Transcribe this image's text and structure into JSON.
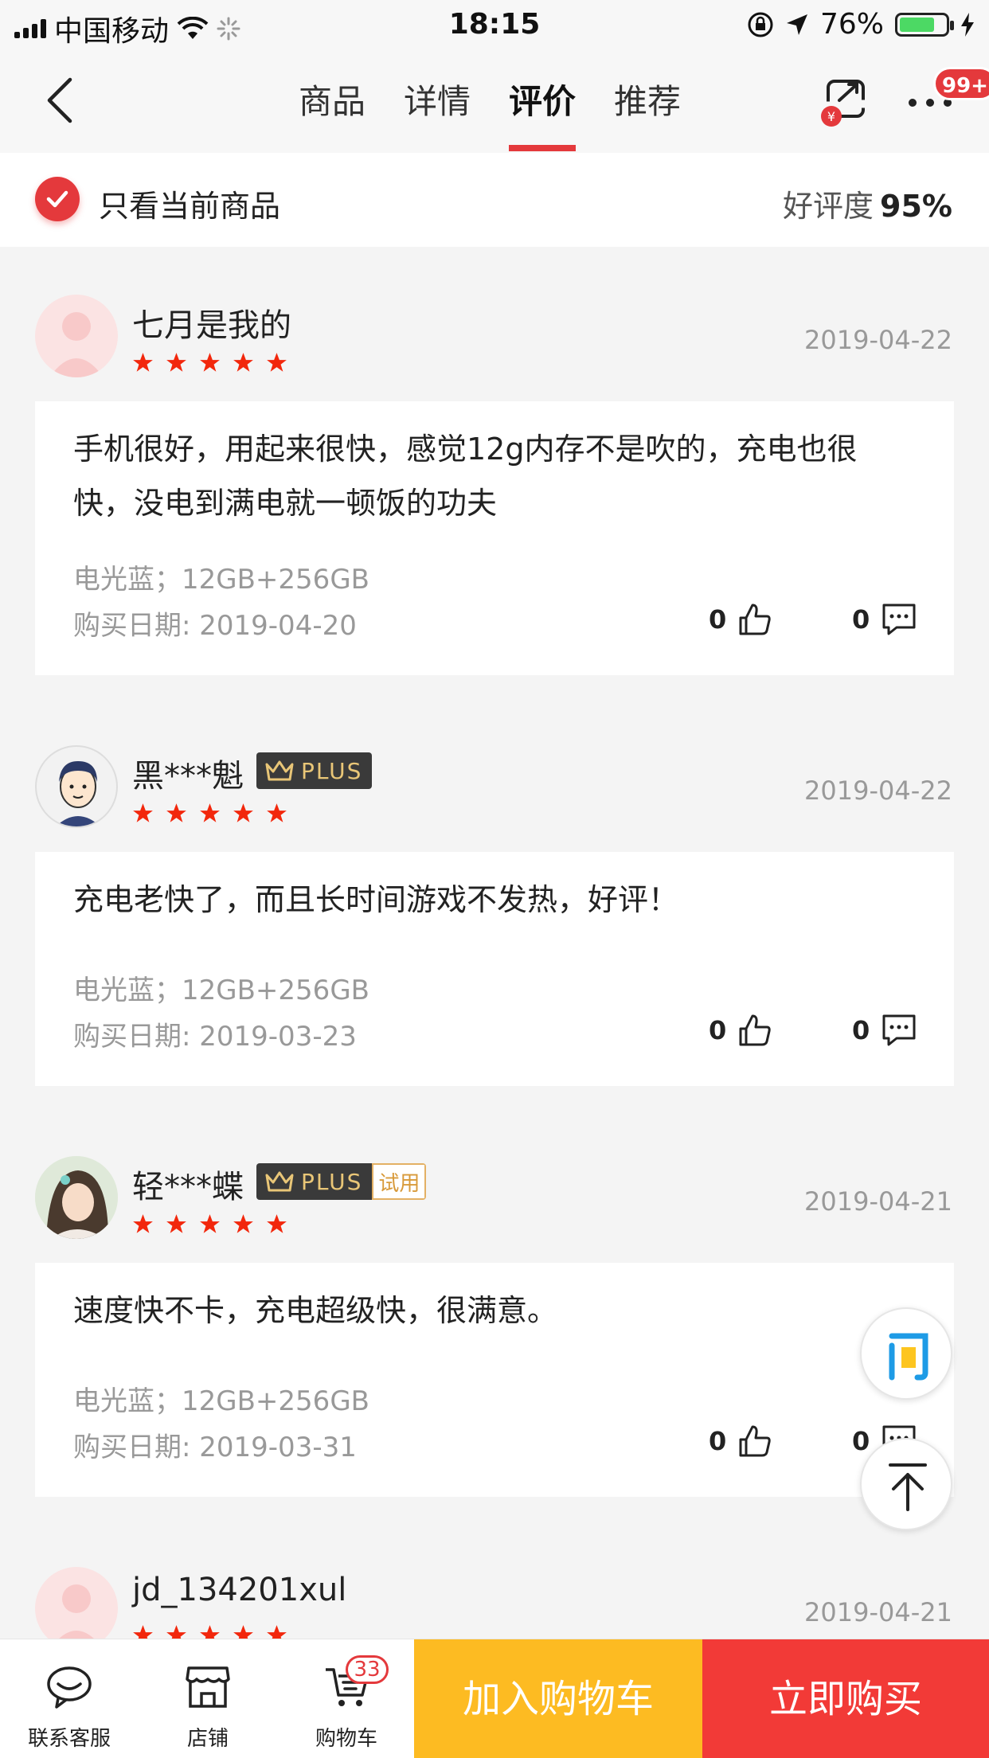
{
  "status_bar": {
    "carrier": "中国移动",
    "time": "18:15",
    "battery": "76%",
    "battery_level": 0.76
  },
  "nav": {
    "tabs": [
      {
        "label": "商品",
        "active": false
      },
      {
        "label": "详情",
        "active": false
      },
      {
        "label": "评价",
        "active": true
      },
      {
        "label": "推荐",
        "active": false
      }
    ],
    "more_badge": "99+"
  },
  "filter": {
    "label": "只看当前商品",
    "rating_label": "好评度",
    "rating_value": "95%"
  },
  "reviews": [
    {
      "username": "七月是我的",
      "plus": false,
      "trial": false,
      "date": "2019-04-22",
      "stars": 5,
      "content": "手机很好，用起来很快，感觉12g内存不是吹的，充电也很快，没电到满电就一顿饭的功夫",
      "spec": "电光蓝；12GB+256GB",
      "purchase_date": "购买日期: 2019-04-20",
      "likes": "0",
      "comments": "0"
    },
    {
      "username": "黑***魁",
      "plus": true,
      "plus_label": "PLUS",
      "trial": false,
      "date": "2019-04-22",
      "stars": 5,
      "content": "充电老快了，而且长时间游戏不发热，好评！",
      "spec": "电光蓝；12GB+256GB",
      "purchase_date": "购买日期: 2019-03-23",
      "likes": "0",
      "comments": "0"
    },
    {
      "username": "轻***蝶",
      "plus": true,
      "plus_label": "PLUS",
      "trial": true,
      "trial_label": "试用",
      "date": "2019-04-21",
      "stars": 5,
      "content": "速度快不卡，充电超级快，很满意。",
      "spec": "电光蓝；12GB+256GB",
      "purchase_date": "购买日期: 2019-03-31",
      "likes": "0",
      "comments": "0"
    },
    {
      "username": "jd_134201xul",
      "plus": false,
      "trial": false,
      "date": "2019-04-21",
      "stars": 5
    }
  ],
  "floating": {
    "ask_icon": "问"
  },
  "bottom_bar": {
    "service_label": "联系客服",
    "shop_label": "店铺",
    "cart_label": "购物车",
    "cart_count": "33",
    "add_to_cart": "加入购物车",
    "buy_now": "立即购买"
  },
  "colors": {
    "accent": "#e4393c",
    "cart_button": "#fdbb22",
    "buy_button": "#f23a37",
    "star": "#f2270c"
  }
}
